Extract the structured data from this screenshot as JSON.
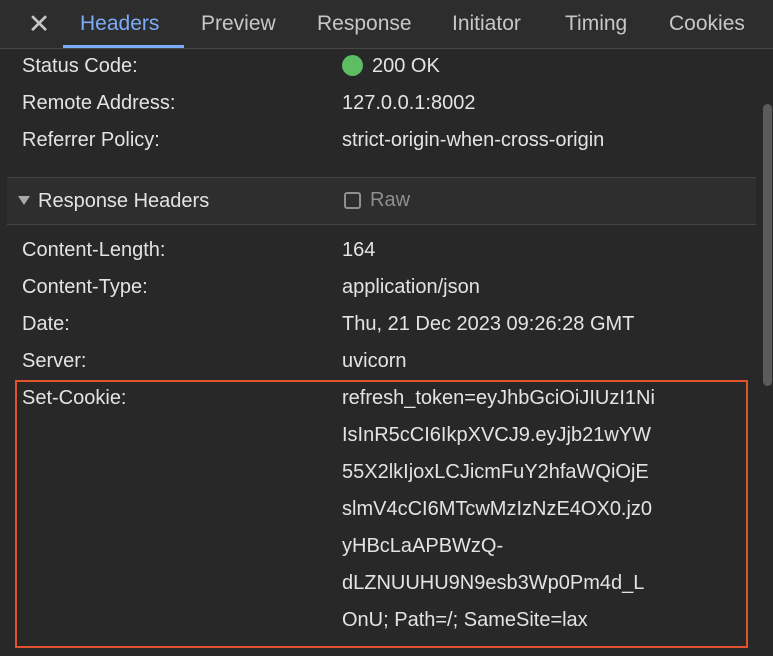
{
  "tabs": {
    "close_label": "✕",
    "items": [
      "Headers",
      "Preview",
      "Response",
      "Initiator",
      "Timing",
      "Cookies"
    ],
    "active": "Headers"
  },
  "general": {
    "status_code_label": "Status Code:",
    "status_code_value": "200 OK",
    "remote_address_label": "Remote Address:",
    "remote_address_value": "127.0.0.1:8002",
    "referrer_policy_label": "Referrer Policy:",
    "referrer_policy_value": "strict-origin-when-cross-origin"
  },
  "response_headers": {
    "title": "Response Headers",
    "raw_label": "Raw",
    "raw_checked": false,
    "content_length_label": "Content-Length:",
    "content_length_value": "164",
    "content_type_label": "Content-Type:",
    "content_type_value": "application/json",
    "date_label": "Date:",
    "date_value": "Thu, 21 Dec 2023 09:26:28 GMT",
    "server_label": "Server:",
    "server_value": "uvicorn",
    "set_cookie_label": "Set-Cookie:",
    "set_cookie_lines": [
      "refresh_token=eyJhbGciOiJIUzI1Ni",
      "IsInR5cCI6IkpXVCJ9.eyJjb21wYW",
      "55X2lkIjoxLCJicmFuY2hfaWQiOjE",
      "slmV4cCI6MTcwMzIzNzE4OX0.jz0",
      "yHBcLaAPBWzQ-",
      "dLZNUUHU9N9esb3Wp0Pm4d_L",
      "OnU; Path=/; SameSite=lax"
    ]
  },
  "colors": {
    "status_ok": "#5cbd63",
    "active_tab": "#7cacf8",
    "highlight": "#e0532d"
  }
}
